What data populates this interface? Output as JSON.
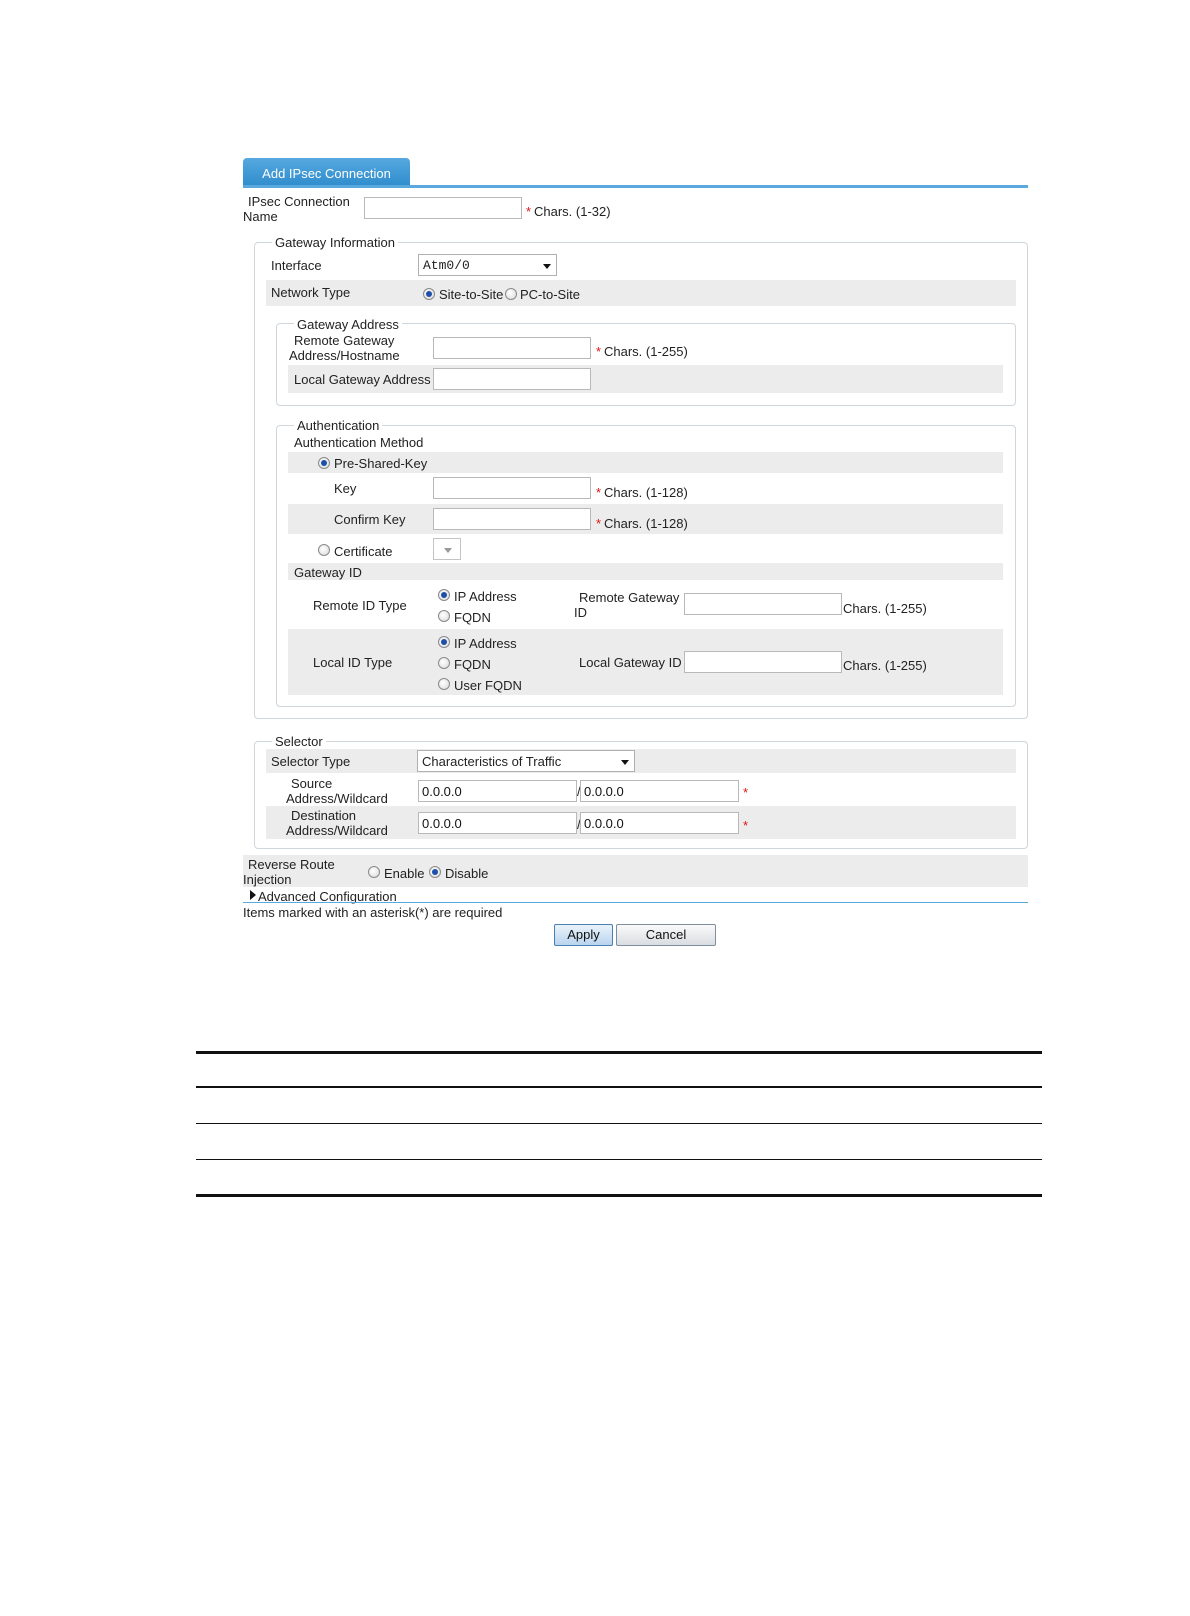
{
  "tab_title": "Add IPsec Connection",
  "connection_name": {
    "label_line1": "IPsec Connection",
    "label_line2": "Name",
    "value": "",
    "hint": "Chars. (1-32)"
  },
  "gateway_info": {
    "legend": "Gateway Information",
    "interface_label": "Interface",
    "interface_value": "Atm0/0",
    "network_type_label": "Network Type",
    "network_types": [
      "Site-to-Site",
      "PC-to-Site"
    ],
    "network_type_selected": "Site-to-Site",
    "gateway_address": {
      "legend": "Gateway Address",
      "remote_label_line1": "Remote Gateway",
      "remote_label_line2": "Address/Hostname",
      "remote_hint": "Chars. (1-255)",
      "local_label": "Local Gateway Address"
    },
    "authentication": {
      "legend": "Authentication",
      "method_label": "Authentication Method",
      "psk_label": "Pre-Shared-Key",
      "key_label": "Key",
      "key_hint": "Chars. (1-128)",
      "confirm_label": "Confirm Key",
      "confirm_hint": "Chars. (1-128)",
      "certificate_label": "Certificate",
      "gateway_id_label": "Gateway ID",
      "remote_id_type_label": "Remote ID Type",
      "remote_id_types": [
        "IP Address",
        "FQDN"
      ],
      "remote_gw_id_line1": "Remote Gateway",
      "remote_gw_id_line2": "ID",
      "remote_gw_id_hint": "Chars. (1-255)",
      "local_id_type_label": "Local ID Type",
      "local_id_types": [
        "IP Address",
        "FQDN",
        "User FQDN"
      ],
      "local_gw_id_label": "Local Gateway ID",
      "local_gw_id_hint": "Chars. (1-255)"
    }
  },
  "selector": {
    "legend": "Selector",
    "type_label": "Selector Type",
    "type_value": "Characteristics of Traffic",
    "source_line1": "Source",
    "source_line2": "Address/Wildcard",
    "source_address": "0.0.0.0",
    "source_wildcard": "0.0.0.0",
    "dest_line1": "Destination",
    "dest_line2": "Address/Wildcard",
    "dest_address": "0.0.0.0",
    "dest_wildcard": "0.0.0.0",
    "slash": "/"
  },
  "rri": {
    "label_line1": "Reverse Route",
    "label_line2": "Injection",
    "enable": "Enable",
    "disable": "Disable"
  },
  "advanced_label": "Advanced Configuration",
  "required_note": "Items marked with an asterisk(*) are required",
  "star": "*",
  "buttons": {
    "apply": "Apply",
    "cancel": "Cancel"
  }
}
